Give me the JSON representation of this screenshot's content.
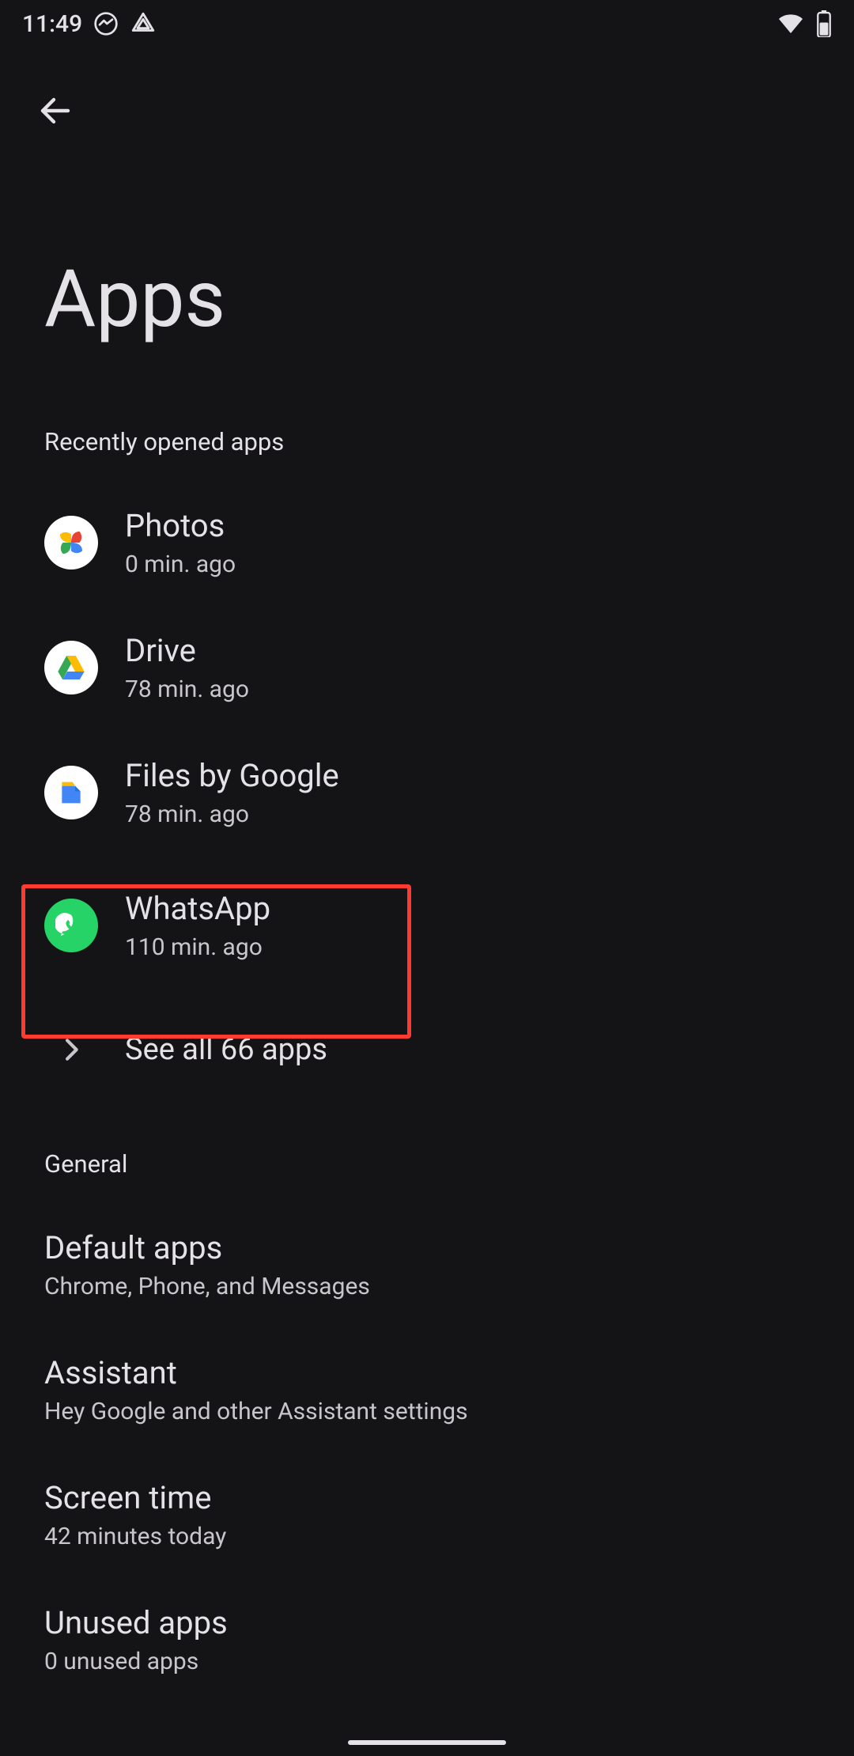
{
  "status": {
    "time": "11:49"
  },
  "header": {
    "back_label": "Back",
    "title": "Apps"
  },
  "sections": {
    "recent": {
      "header": "Recently opened apps",
      "apps": [
        {
          "name": "Photos",
          "subtitle": "0 min. ago",
          "icon": "photos"
        },
        {
          "name": "Drive",
          "subtitle": "78 min. ago",
          "icon": "drive"
        },
        {
          "name": "Files by Google",
          "subtitle": "78 min. ago",
          "icon": "files"
        },
        {
          "name": "WhatsApp",
          "subtitle": "110 min. ago",
          "icon": "whatsapp"
        }
      ],
      "see_all": "See all 66 apps"
    },
    "general": {
      "header": "General",
      "items": [
        {
          "title": "Default apps",
          "subtitle": "Chrome, Phone, and Messages"
        },
        {
          "title": "Assistant",
          "subtitle": "Hey Google and other Assistant settings"
        },
        {
          "title": "Screen time",
          "subtitle": "42 minutes today"
        },
        {
          "title": "Unused apps",
          "subtitle": "0 unused apps"
        }
      ]
    }
  },
  "highlight": {
    "target": "whatsapp-row"
  }
}
